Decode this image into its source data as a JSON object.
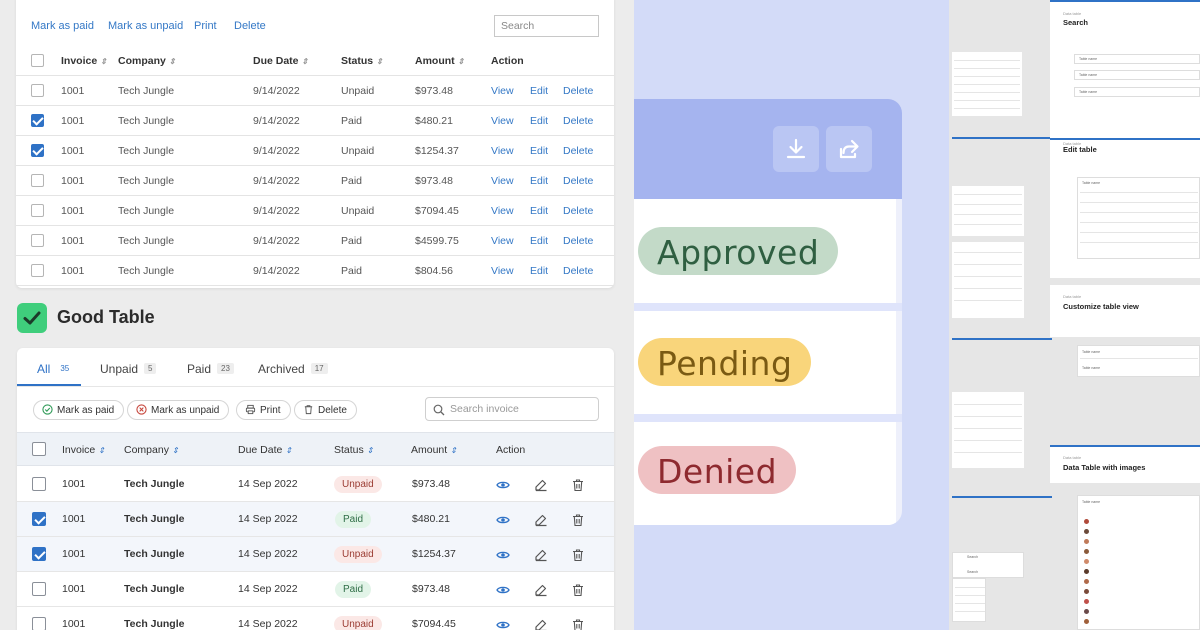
{
  "bad_table": {
    "toolbar": {
      "mark_paid": "Mark as paid",
      "mark_unpaid": "Mark as unpaid",
      "print": "Print",
      "delete": "Delete"
    },
    "search_placeholder": "Search",
    "headers": {
      "invoice": "Invoice",
      "company": "Company",
      "due_date": "Due Date",
      "status": "Status",
      "amount": "Amount",
      "action": "Action"
    },
    "actions": {
      "view": "View",
      "edit": "Edit",
      "delete": "Delete"
    },
    "rows": [
      {
        "invoice": "1001",
        "company": "Tech Jungle",
        "due": "9/14/2022",
        "status": "Unpaid",
        "amount": "$973.48",
        "checked": false
      },
      {
        "invoice": "1001",
        "company": "Tech Jungle",
        "due": "9/14/2022",
        "status": "Paid",
        "amount": "$480.21",
        "checked": true
      },
      {
        "invoice": "1001",
        "company": "Tech Jungle",
        "due": "9/14/2022",
        "status": "Unpaid",
        "amount": "$1254.37",
        "checked": true
      },
      {
        "invoice": "1001",
        "company": "Tech Jungle",
        "due": "9/14/2022",
        "status": "Paid",
        "amount": "$973.48",
        "checked": false
      },
      {
        "invoice": "1001",
        "company": "Tech Jungle",
        "due": "9/14/2022",
        "status": "Unpaid",
        "amount": "$7094.45",
        "checked": false
      },
      {
        "invoice": "1001",
        "company": "Tech Jungle",
        "due": "9/14/2022",
        "status": "Paid",
        "amount": "$4599.75",
        "checked": false
      },
      {
        "invoice": "1001",
        "company": "Tech Jungle",
        "due": "9/14/2022",
        "status": "Paid",
        "amount": "$804.56",
        "checked": false
      }
    ]
  },
  "good_table": {
    "title": "Good Table",
    "tabs": [
      {
        "label": "All",
        "count": "35"
      },
      {
        "label": "Unpaid",
        "count": "5"
      },
      {
        "label": "Paid",
        "count": "23"
      },
      {
        "label": "Archived",
        "count": "17"
      }
    ],
    "toolbar": {
      "mark_paid": "Mark as paid",
      "mark_unpaid": "Mark as unpaid",
      "print": "Print",
      "delete": "Delete"
    },
    "search_placeholder": "Search invoice",
    "headers": {
      "invoice": "Invoice",
      "company": "Company",
      "due_date": "Due Date",
      "status": "Status",
      "amount": "Amount",
      "action": "Action"
    },
    "rows": [
      {
        "invoice": "1001",
        "company": "Tech Jungle",
        "due": "14 Sep 2022",
        "status": "Unpaid",
        "amount": "$973.48",
        "checked": false
      },
      {
        "invoice": "1001",
        "company": "Tech Jungle",
        "due": "14 Sep 2022",
        "status": "Paid",
        "amount": "$480.21",
        "checked": true
      },
      {
        "invoice": "1001",
        "company": "Tech Jungle",
        "due": "14 Sep 2022",
        "status": "Unpaid",
        "amount": "$1254.37",
        "checked": true
      },
      {
        "invoice": "1001",
        "company": "Tech Jungle",
        "due": "14 Sep 2022",
        "status": "Paid",
        "amount": "$973.48",
        "checked": false
      },
      {
        "invoice": "1001",
        "company": "Tech Jungle",
        "due": "14 Sep 2022",
        "status": "Unpaid",
        "amount": "$7094.45",
        "checked": false
      }
    ]
  },
  "status_badges": {
    "approved": "Approved",
    "pending": "Pending",
    "denied": "Denied"
  },
  "right_panel": {
    "sections": [
      {
        "small": "Data table",
        "title": "Search"
      },
      {
        "small": "Data table",
        "title": "Edit table"
      },
      {
        "small": "Data table",
        "title": "Customize table view"
      },
      {
        "small": "Data table",
        "title": "Data Table with images"
      }
    ],
    "mini_labels": {
      "table_name": "Table name",
      "search": "Search"
    }
  },
  "colors": {
    "accent": "#2f72c6",
    "good_badge": "#3fce7c",
    "mid_bg": "#d3dbf8",
    "mid_header": "#a5b4ef"
  }
}
